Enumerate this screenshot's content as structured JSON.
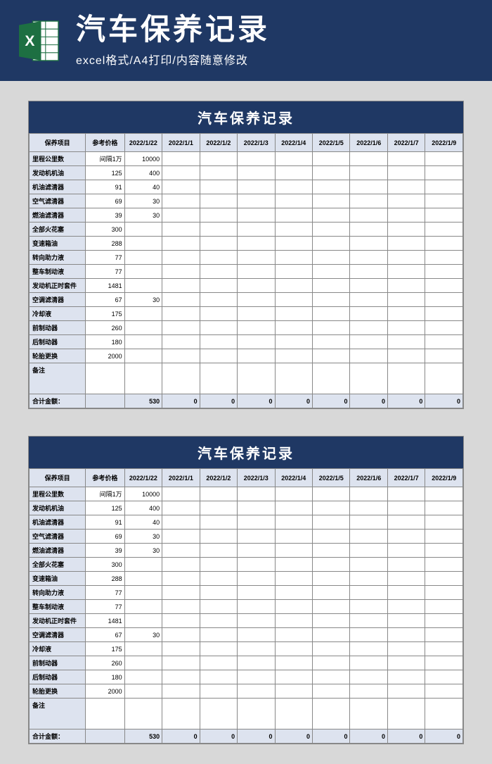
{
  "header": {
    "title": "汽车保养记录",
    "subtitle": "excel格式/A4打印/内容随意修改"
  },
  "sheet": {
    "title": "汽车保养记录",
    "columns": {
      "item": "保养项目",
      "price": "参考价格",
      "dates": [
        "2022/1/22",
        "2022/1/1",
        "2022/1/2",
        "2022/1/3",
        "2022/1/4",
        "2022/1/5",
        "2022/1/6",
        "2022/1/7",
        "2022/1/9"
      ]
    },
    "rows": [
      {
        "name": "里程公里数",
        "price": "间隔1万",
        "values": [
          "10000",
          "",
          "",
          "",
          "",
          "",
          "",
          "",
          ""
        ]
      },
      {
        "name": "发动机机油",
        "price": "125",
        "values": [
          "400",
          "",
          "",
          "",
          "",
          "",
          "",
          "",
          ""
        ]
      },
      {
        "name": "机油滤清器",
        "price": "91",
        "values": [
          "40",
          "",
          "",
          "",
          "",
          "",
          "",
          "",
          ""
        ]
      },
      {
        "name": "空气滤清器",
        "price": "69",
        "values": [
          "30",
          "",
          "",
          "",
          "",
          "",
          "",
          "",
          ""
        ]
      },
      {
        "name": "燃油滤清器",
        "price": "39",
        "values": [
          "30",
          "",
          "",
          "",
          "",
          "",
          "",
          "",
          ""
        ]
      },
      {
        "name": "全部火花塞",
        "price": "300",
        "values": [
          "",
          "",
          "",
          "",
          "",
          "",
          "",
          "",
          ""
        ]
      },
      {
        "name": "变速箱油",
        "price": "288",
        "values": [
          "",
          "",
          "",
          "",
          "",
          "",
          "",
          "",
          ""
        ]
      },
      {
        "name": "转向助力液",
        "price": "77",
        "values": [
          "",
          "",
          "",
          "",
          "",
          "",
          "",
          "",
          ""
        ]
      },
      {
        "name": "整车制动液",
        "price": "77",
        "values": [
          "",
          "",
          "",
          "",
          "",
          "",
          "",
          "",
          ""
        ]
      },
      {
        "name": "发动机正时套件",
        "price": "1481",
        "values": [
          "",
          "",
          "",
          "",
          "",
          "",
          "",
          "",
          ""
        ]
      },
      {
        "name": "空调滤清器",
        "price": "67",
        "values": [
          "30",
          "",
          "",
          "",
          "",
          "",
          "",
          "",
          ""
        ]
      },
      {
        "name": "冷却液",
        "price": "175",
        "values": [
          "",
          "",
          "",
          "",
          "",
          "",
          "",
          "",
          ""
        ]
      },
      {
        "name": "前制动器",
        "price": "260",
        "values": [
          "",
          "",
          "",
          "",
          "",
          "",
          "",
          "",
          ""
        ]
      },
      {
        "name": "后制动器",
        "price": "180",
        "values": [
          "",
          "",
          "",
          "",
          "",
          "",
          "",
          "",
          ""
        ]
      },
      {
        "name": "轮胎更换",
        "price": "2000",
        "values": [
          "",
          "",
          "",
          "",
          "",
          "",
          "",
          "",
          ""
        ]
      }
    ],
    "remark_label": "备注",
    "total_label": "合计金额：",
    "totals": [
      "",
      "530",
      "0",
      "0",
      "0",
      "0",
      "0",
      "0",
      "0",
      "0"
    ]
  }
}
